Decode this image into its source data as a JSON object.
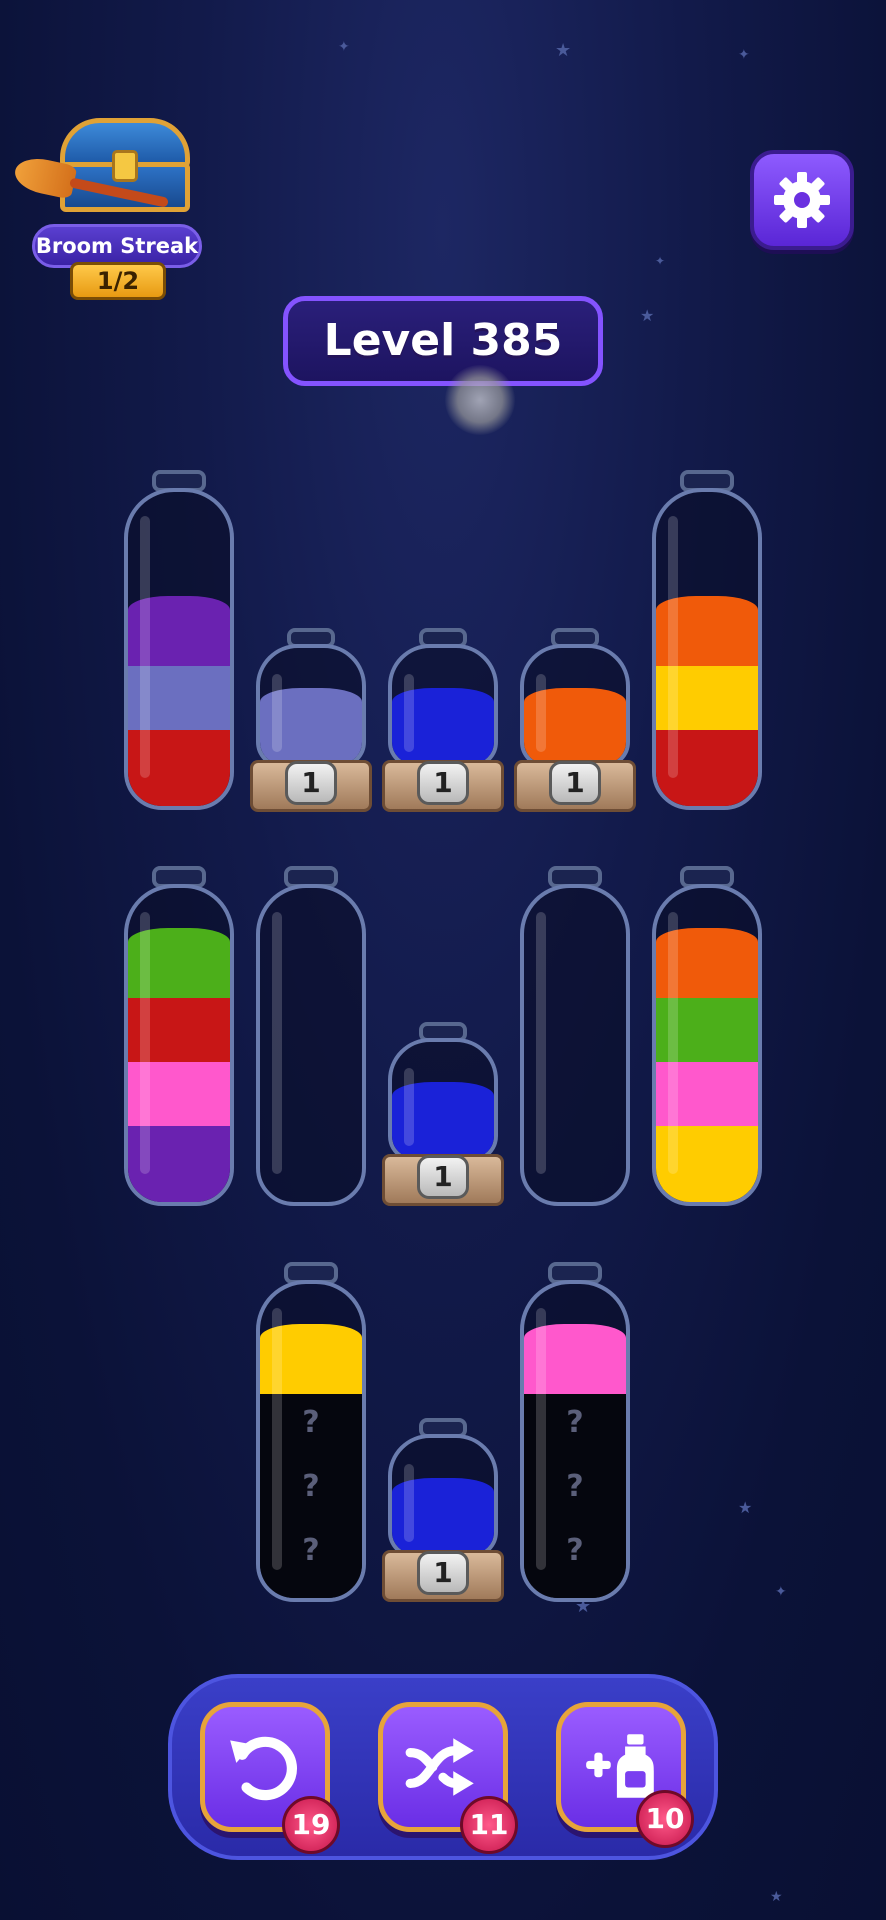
{
  "header": {
    "streak_title": "Broom Streak",
    "streak_progress": "1/2",
    "level_label": "Level 385"
  },
  "colors": {
    "purple": "#6a22b0",
    "lavender": "#6b6fc0",
    "red": "#c81616",
    "blue": "#1a22d8",
    "orange": "#f05a0a",
    "yellow": "#ffcc00",
    "green": "#4caf1a",
    "pink": "#ff58cc",
    "hidden": "#05060e"
  },
  "bottles": [
    {
      "layers": [
        "purple",
        "lavender",
        "red"
      ]
    },
    {
      "layers": [
        "orange",
        "yellow",
        "red"
      ]
    },
    {
      "layers": [
        "green",
        "red",
        "pink",
        "purple"
      ]
    },
    {
      "layers": []
    },
    {
      "layers": []
    },
    {
      "layers": [
        "orange",
        "green",
        "pink",
        "yellow"
      ]
    },
    {
      "layers": [
        "yellow",
        "hidden",
        "hidden",
        "hidden"
      ],
      "hidden_marks": [
        "?",
        "?",
        "?"
      ]
    },
    {
      "layers": [
        "pink",
        "hidden",
        "hidden",
        "hidden"
      ],
      "hidden_marks": [
        "?",
        "?",
        "?"
      ]
    }
  ],
  "flasks": [
    {
      "color": "lavender",
      "capacity_label": "1"
    },
    {
      "color": "blue",
      "capacity_label": "1"
    },
    {
      "color": "orange",
      "capacity_label": "1"
    },
    {
      "color": "blue",
      "capacity_label": "1"
    },
    {
      "color": "blue",
      "capacity_label": "1"
    }
  ],
  "tools": {
    "undo": {
      "icon": "undo-icon",
      "count": "19"
    },
    "shuffle": {
      "icon": "shuffle-icon",
      "count": "11"
    },
    "add_bottle": {
      "icon": "add-bottle-icon",
      "count": "10"
    }
  }
}
